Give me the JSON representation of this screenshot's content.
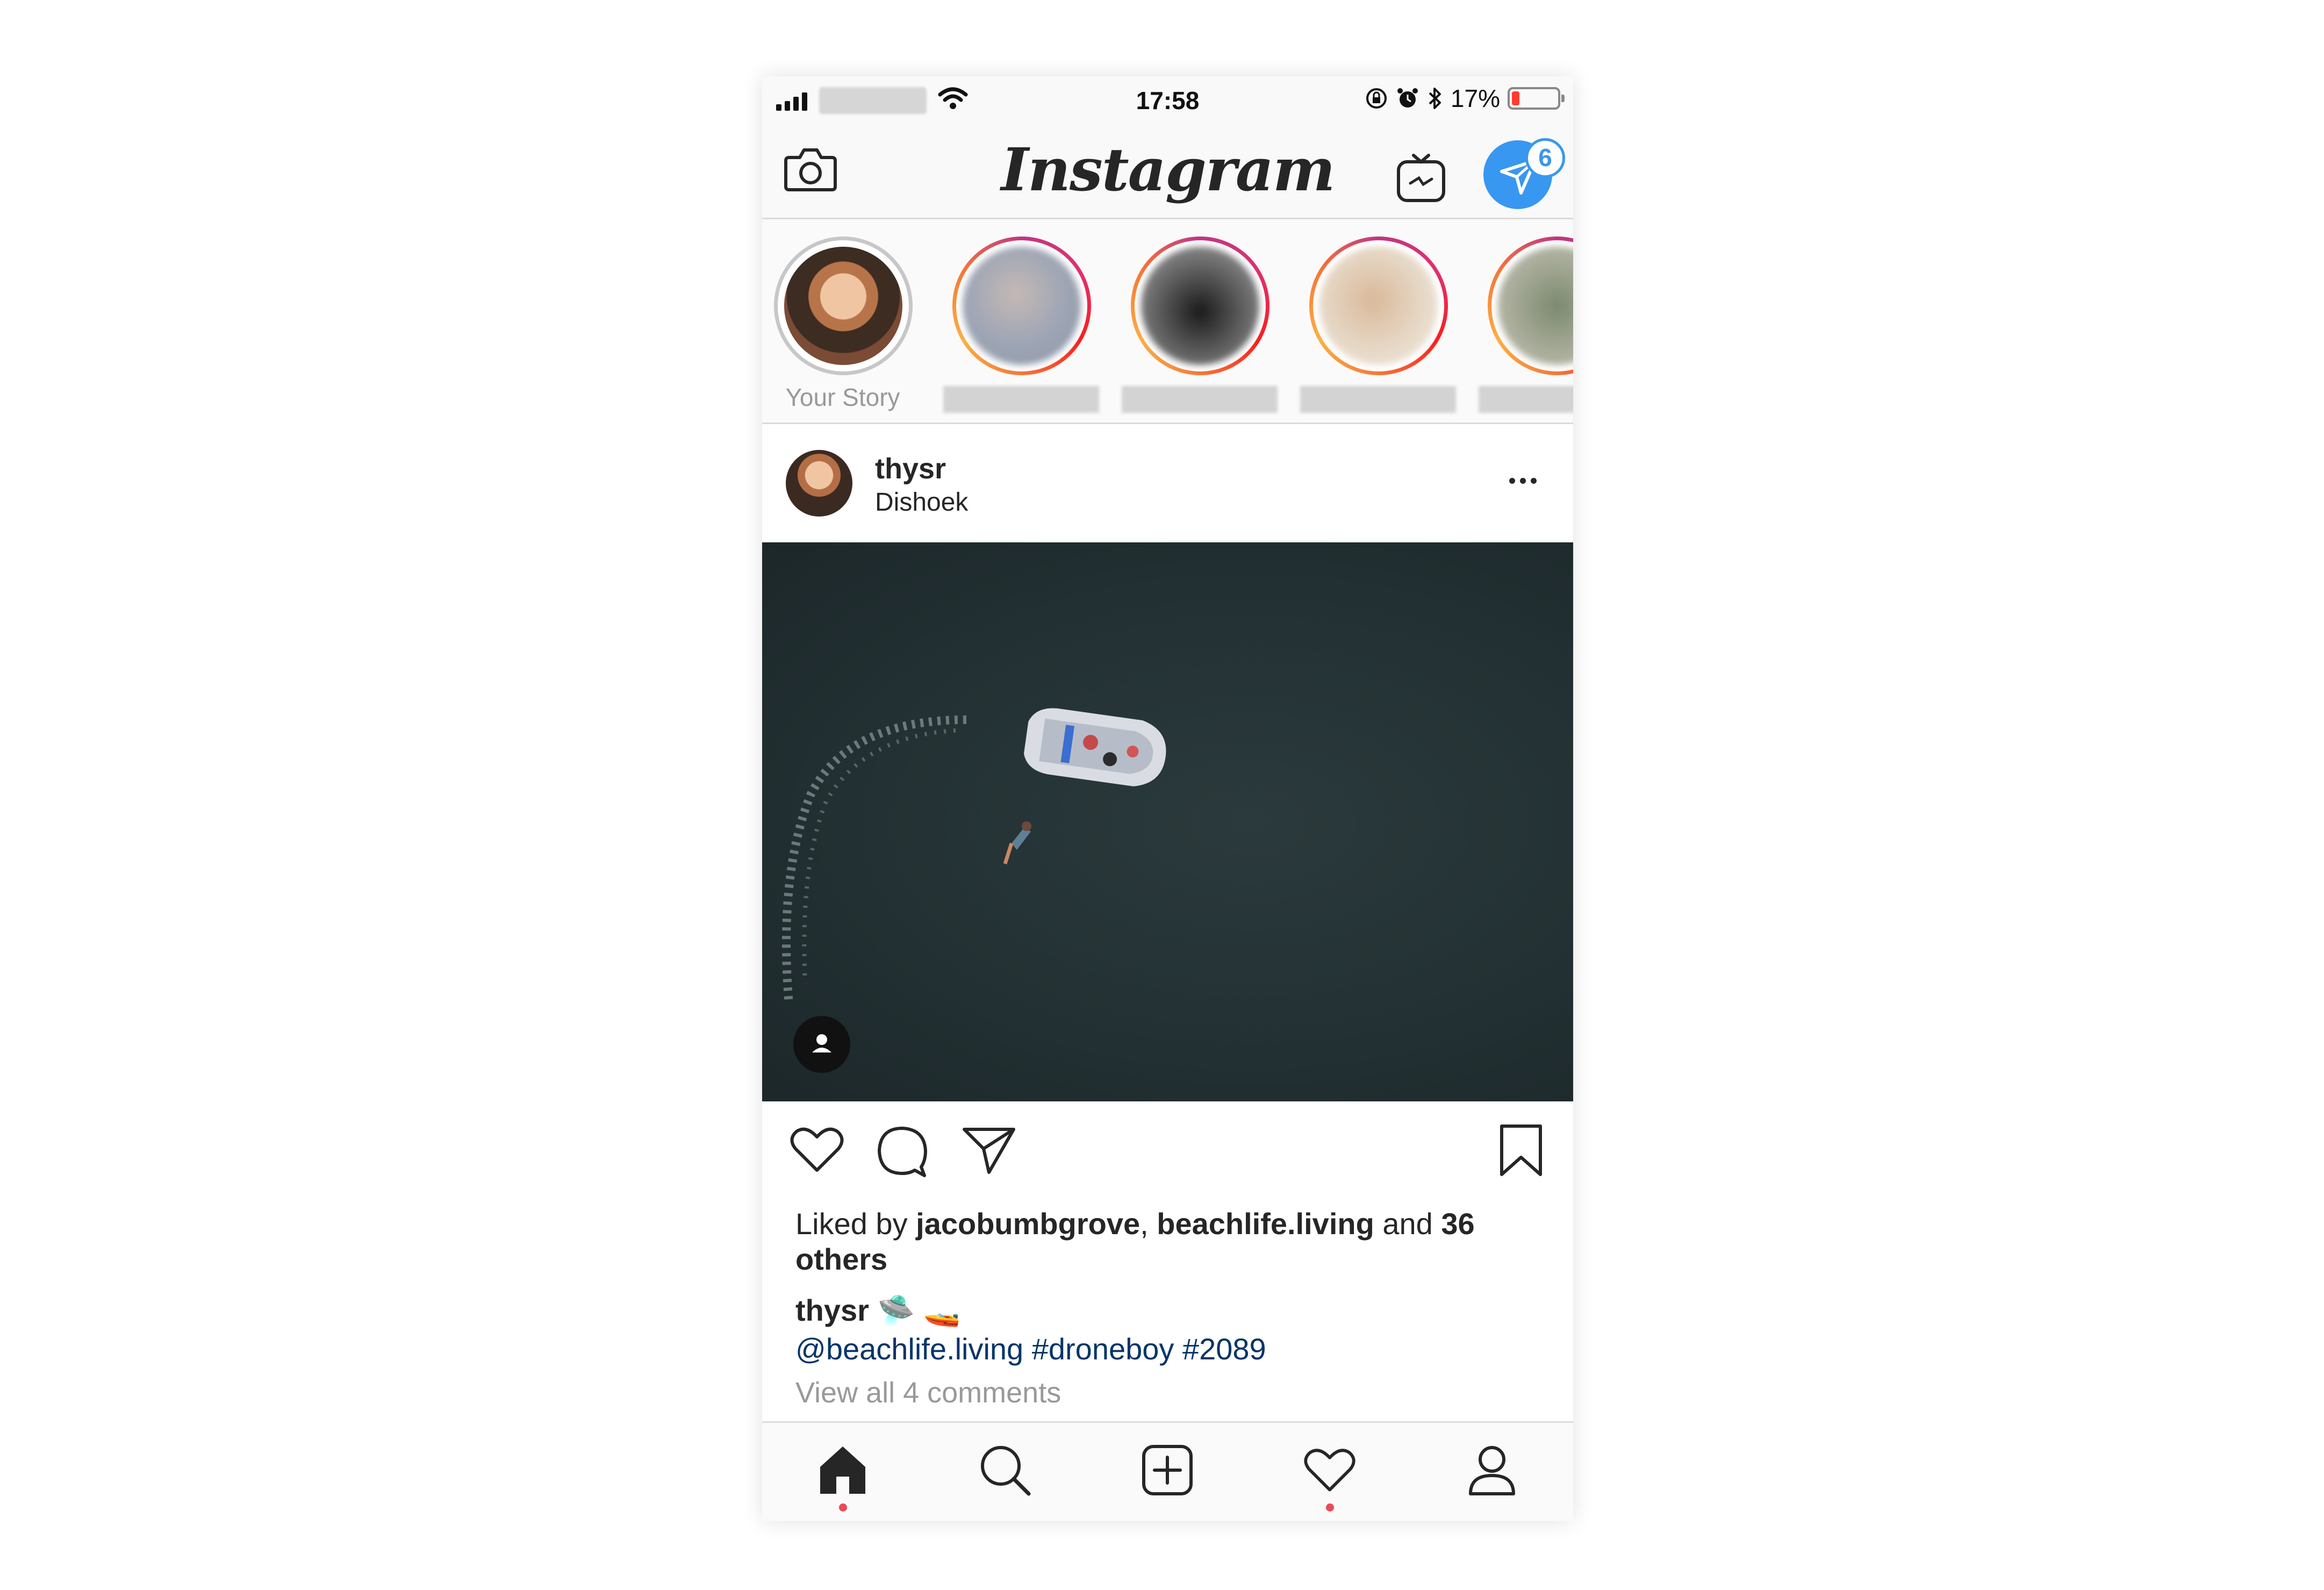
{
  "status_bar": {
    "time": "17:58",
    "battery_percent_text": "17%",
    "battery_level": 0.17,
    "icons": [
      "signal-bars-icon",
      "wifi-icon",
      "rotation-lock-icon",
      "alarm-icon",
      "bluetooth-icon",
      "battery-icon"
    ]
  },
  "header": {
    "logo": "Instagram",
    "direct_badge_count": "6",
    "icons": [
      "camera-icon",
      "igtv-icon",
      "direct-message-icon"
    ]
  },
  "stories": [
    {
      "label": "Your Story",
      "seen": true
    },
    {
      "label": "",
      "seen": false
    },
    {
      "label": "",
      "seen": false
    },
    {
      "label": "",
      "seen": false
    },
    {
      "label": "",
      "seen": false
    }
  ],
  "post": {
    "username": "thysr",
    "location": "Dishoek",
    "likes_prefix": "Liked by",
    "liked_by_1": "jacobumbgrove",
    "liked_by_2": "beachlife.living",
    "likes_and": "and",
    "likes_others": "36 others",
    "caption_user": "thysr",
    "caption_emoji": "🛸 🚤",
    "caption_tags": "@beachlife.living #droneboy #2089",
    "view_comments": "View all 4 comments"
  },
  "tab_bar": {
    "tabs": [
      "home",
      "search",
      "new-post",
      "activity",
      "profile"
    ],
    "notification_dots": [
      "home",
      "activity"
    ]
  },
  "colors": {
    "link": "#003569",
    "badge": "#3897f0",
    "notification_dot": "#ed4956",
    "battery_low": "#ff3b30"
  }
}
